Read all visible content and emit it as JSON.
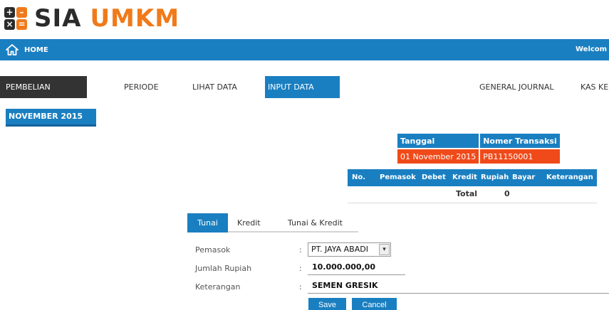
{
  "logo": {
    "icon_glyphs": [
      "+",
      "–",
      "×",
      "="
    ],
    "text_primary": "SIA",
    "text_secondary": "UMKM",
    "colors": {
      "dark": "#2b2b2b",
      "orange": "#f07a1a"
    }
  },
  "topbar": {
    "home_label": "HOME",
    "home_icon": "home-icon",
    "welcome_text": "Welcom",
    "color": "#1a7fc1"
  },
  "menu": {
    "items": [
      {
        "label": "PEMBELIAN"
      },
      {
        "label": "PERIODE"
      },
      {
        "label": "LIHAT DATA"
      },
      {
        "label": "INPUT DATA",
        "active": true
      },
      {
        "label": "GENERAL JOURNAL"
      },
      {
        "label": "KAS KE"
      }
    ]
  },
  "period": {
    "label": "NOVEMBER 2015"
  },
  "transaction": {
    "headers": [
      "Tanggal",
      "Nomer Transaksi"
    ],
    "values": [
      "01 November 2015",
      "PB11150001"
    ],
    "value_color": "#f04a1a"
  },
  "detail_table": {
    "columns": [
      "No.",
      "Pemasok",
      "Debet",
      "Kredit",
      "Rupiah",
      "Bayar",
      "Keterangan"
    ],
    "total_label": "Total",
    "total_value": "0"
  },
  "tabs": [
    {
      "label": "Tunai",
      "active": true
    },
    {
      "label": "Kredit"
    },
    {
      "label": "Tunai & Kredit"
    }
  ],
  "form": {
    "pemasok": {
      "label": "Pemasok",
      "value": "PT. JAYA ABADI",
      "arrow": "▾"
    },
    "jumlah": {
      "label": "Jumlah Rupiah",
      "value": "10.000.000,00"
    },
    "keterangan": {
      "label": "Keterangan",
      "value": "SEMEN GRESIK"
    },
    "colon": ":"
  },
  "buttons": {
    "save": "Save",
    "cancel": "Cancel"
  }
}
